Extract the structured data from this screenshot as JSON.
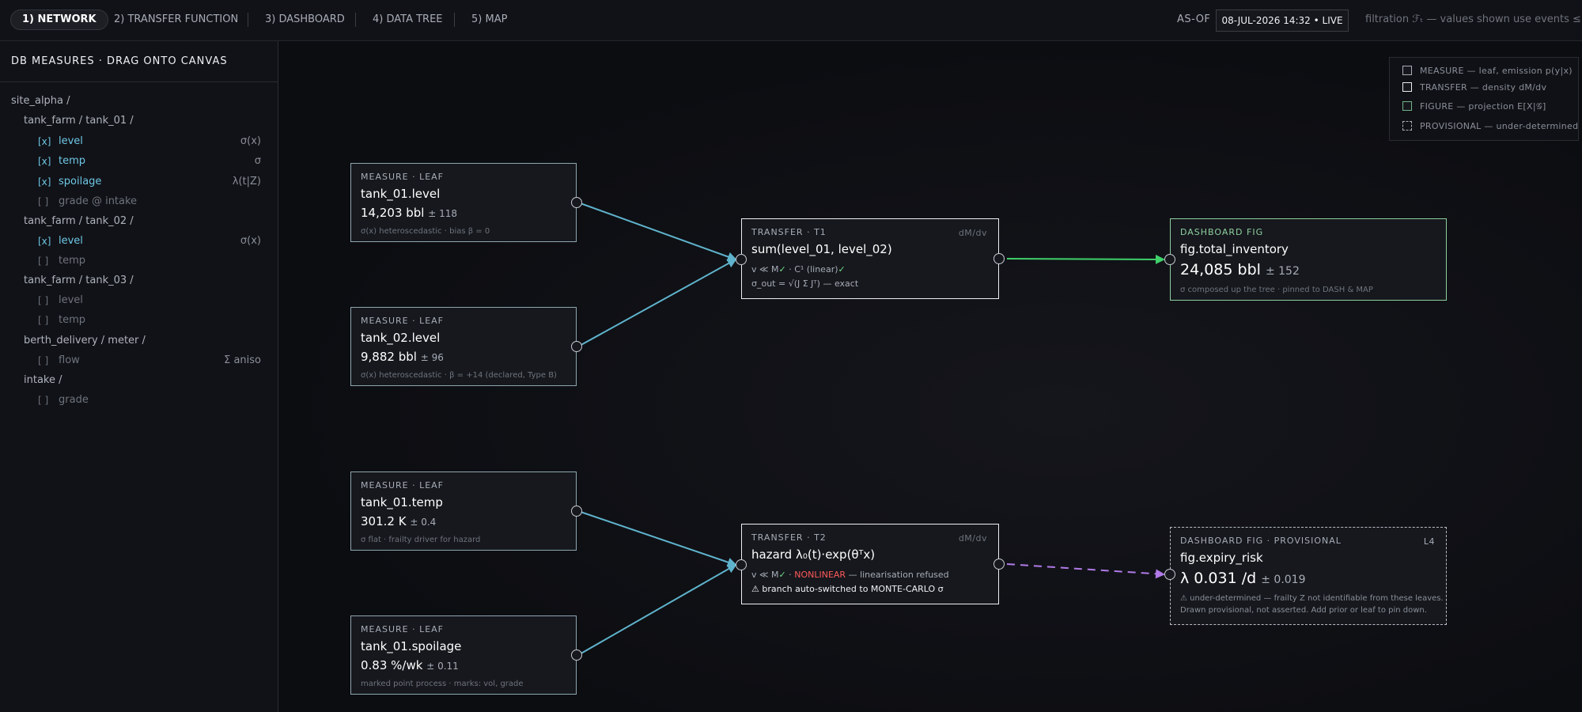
{
  "tabs": [
    {
      "label": "1) NETWORK",
      "active": true
    },
    {
      "label": "2) TRANSFER FUNCTION"
    },
    {
      "label": "3) DASHBOARD"
    },
    {
      "label": "4) DATA TREE"
    },
    {
      "label": "5) MAP"
    }
  ],
  "asof": {
    "label": "AS-OF",
    "value": "08-JUL-2026 14:32 • LIVE"
  },
  "filtration_note": "filtration ℱₜ — values shown use events ≤ t only",
  "sidebar": {
    "title": "DB MEASURES · DRAG ONTO CANVAS",
    "tree": [
      {
        "folder": "site_alpha /"
      },
      {
        "folder": "tank_farm / tank_01 /"
      },
      {
        "check": "[x]",
        "name": "level",
        "meta": "σ(x)"
      },
      {
        "check": "[x]",
        "name": "temp",
        "meta": "σ"
      },
      {
        "check": "[x]",
        "name": "spoilage",
        "meta": "λ(t|Z)"
      },
      {
        "check": "[ ]",
        "name": "grade @ intake",
        "meta": ""
      },
      {
        "folder": "tank_farm / tank_02 /"
      },
      {
        "check": "[x]",
        "name": "level",
        "meta": "σ(x)"
      },
      {
        "check": "[ ]",
        "name": "temp",
        "meta": ""
      },
      {
        "folder": "tank_farm / tank_03 /"
      },
      {
        "check": "[ ]",
        "name": "level",
        "meta": ""
      },
      {
        "check": "[ ]",
        "name": "temp",
        "meta": ""
      },
      {
        "folder": "berth_delivery / meter /"
      },
      {
        "check": "[ ]",
        "name": "flow",
        "meta": "Σ aniso"
      },
      {
        "folder": "intake /"
      },
      {
        "check": "[ ]",
        "name": "grade",
        "meta": ""
      }
    ]
  },
  "legend": [
    {
      "label": "MEASURE — leaf, emission p(y|x)"
    },
    {
      "label": "TRANSFER — density dM/dv"
    },
    {
      "label": "FIGURE — projection E[X|𝒢]"
    },
    {
      "label": "PROVISIONAL — under-determined"
    }
  ],
  "nodes": {
    "m1": {
      "kicker": "MEASURE · LEAF",
      "title": "tank_01.level",
      "value": "14,203 bbl",
      "unc": "± 118",
      "note": "σ(x) heteroscedastic · bias β = 0"
    },
    "m2": {
      "kicker": "MEASURE · LEAF",
      "title": "tank_02.level",
      "value": "9,882 bbl",
      "unc": "± 96",
      "note": "σ(x) heteroscedastic · β = +14 (declared, Type B)"
    },
    "m3": {
      "kicker": "MEASURE · LEAF",
      "title": "tank_01.temp",
      "value": "301.2 K",
      "unc": "± 0.4",
      "note": "σ flat · frailty driver for hazard"
    },
    "m4": {
      "kicker": "MEASURE · LEAF",
      "title": "tank_01.spoilage",
      "value": "0.83 %/wk",
      "unc": "± 0.11",
      "note": "marked point process · marks: vol, grade"
    },
    "t1": {
      "kicker": "TRANSFER · T1",
      "tag": "dM/dv",
      "title": "sum(level_01, level_02)",
      "line1_a": "v ≪ M",
      "line1_b": "✓",
      "line1_c": " · C¹ (linear)",
      "line1_d": "✓",
      "line2": "σ_out = √(J Σ Jᵀ) — exact"
    },
    "t2": {
      "kicker": "TRANSFER · T2",
      "tag": "dM/dv",
      "title": "hazard λ₀(t)·exp(θᵀx)",
      "line1_a": "v ≪ M",
      "line1_b": "✓",
      "line1_c": " · ",
      "line1_d": "NONLINEAR",
      "line1_e": " — linearisation refused",
      "line2": "⚠ branch auto-switched to MONTE-CARLO σ"
    },
    "f1": {
      "kicker": "DASHBOARD FIG",
      "title": "fig.total_inventory",
      "value": "24,085 bbl",
      "unc": "± 152",
      "note": "σ composed up the tree · pinned to DASH & MAP"
    },
    "f2": {
      "kicker": "DASHBOARD FIG · PROVISIONAL",
      "tag": "L4",
      "title": "fig.expiry_risk",
      "value": "λ 0.031 /d",
      "unc": "± 0.019",
      "note1": "⚠ under-determined — frailty Z not identifiable from these leaves.",
      "note2": "Drawn provisional, not asserted. Add prior or leaf to pin down."
    }
  },
  "colors": {
    "edge_measure": "#5fb3cc",
    "edge_figure": "#3fd06a",
    "edge_provisional": "#b07ae8"
  }
}
